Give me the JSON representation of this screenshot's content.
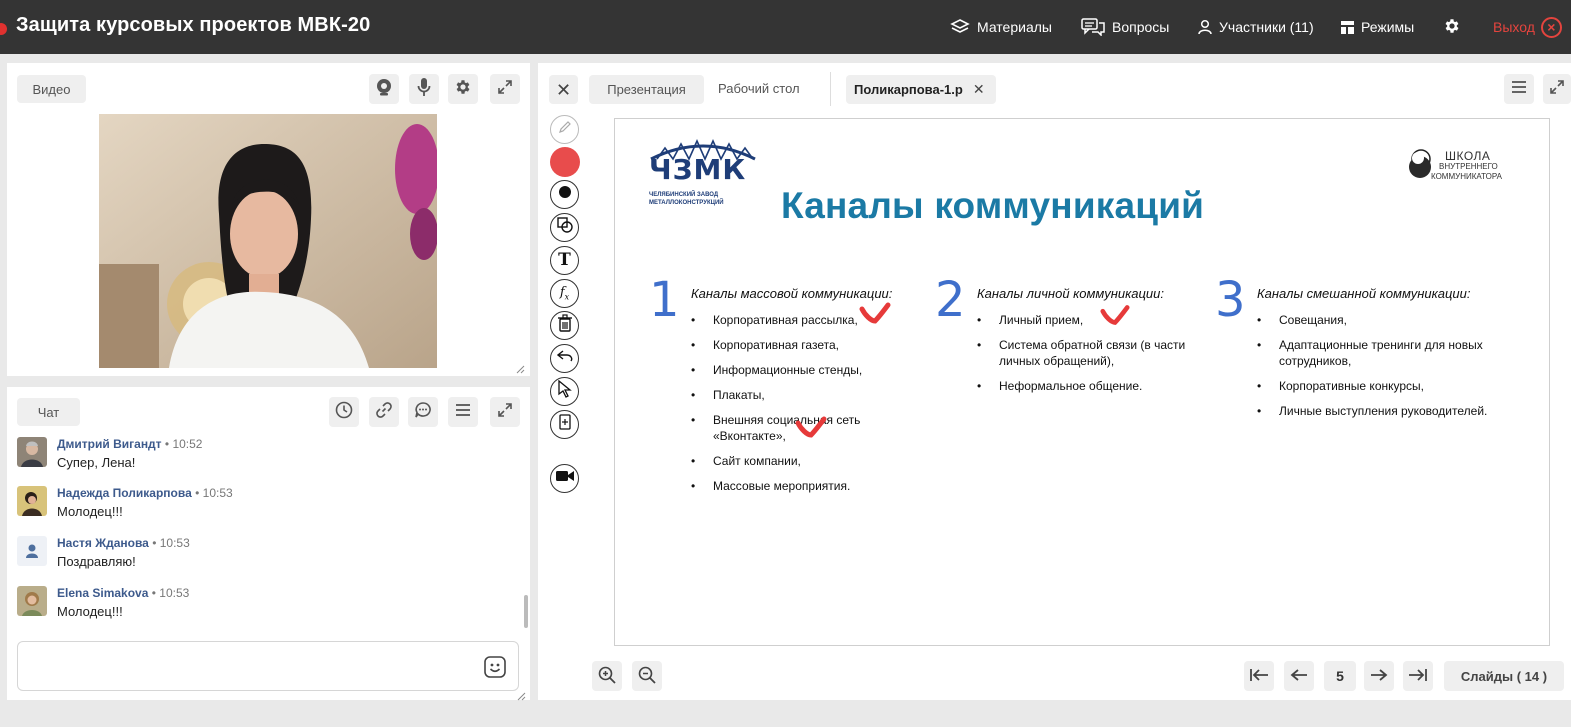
{
  "header": {
    "title": "Защита курсовых проектов МВК-20",
    "nav": {
      "materials": "Материалы",
      "questions": "Вопросы",
      "participants": "Участники (11)",
      "modes": "Режимы",
      "exit": "Выход"
    }
  },
  "video_panel": {
    "tab_label": "Видео"
  },
  "chat_panel": {
    "tab_label": "Чат",
    "messages": [
      {
        "name": "Дмитрий Вигандт",
        "time": "10:52",
        "text": "Супер, Лена!"
      },
      {
        "name": "Надежда Поликарпова",
        "time": "10:53",
        "text": "Молодец!!!"
      },
      {
        "name": "Настя Жданова",
        "time": "10:53",
        "text": "Поздравляю!"
      },
      {
        "name": "Elena Simakova",
        "time": "10:53",
        "text": "Молодец!!!"
      }
    ]
  },
  "presentation": {
    "tabs": {
      "presentation": "Презентация",
      "desktop": "Рабочий стол",
      "file": "Поликарпова-1.р"
    },
    "slide": {
      "logo_left_brand": "ЧЗМК",
      "logo_left_line1": "ЧЕЛЯБИНСКИЙ ЗАВОД",
      "logo_left_line2": "МЕТАЛЛОКОНСТРУКЦИЙ",
      "logo_right_line1": "ШКОЛА",
      "logo_right_line2": "ВНУТРЕННЕГО",
      "logo_right_line3": "КОММУНИКАТОРА",
      "title": "Каналы коммуникаций",
      "columns": [
        {
          "num": "1",
          "heading": "Каналы массовой коммуникации:",
          "items": [
            "Корпоративная рассылка,",
            "Корпоративная газета,",
            "Информационные стенды,",
            "Плакаты,",
            "Внешняя социальная сеть «Вконтакте»,",
            "Сайт компании,",
            "Массовые мероприятия."
          ]
        },
        {
          "num": "2",
          "heading": "Каналы личной коммуникации:",
          "items": [
            "Личный прием,",
            "Система обратной связи (в части личных обращений),",
            "Неформальное общение."
          ]
        },
        {
          "num": "3",
          "heading": "Каналы смешанной коммуникации:",
          "items": [
            "Совещания,",
            "Адаптационные тренинги для новых сотрудников,",
            "Корпоративные конкурсы,",
            "Личные выступления руководителей."
          ]
        }
      ]
    },
    "pager": {
      "current_page": "5",
      "slides_label": "Слайды ( 14 )"
    }
  },
  "colors": {
    "topbar": "#343434",
    "exit": "#e4443e",
    "accent_red": "#e84c4c",
    "slide_title": "#1b7aa5",
    "slide_numbers": "#3f6fcb",
    "chat_name": "#3d5a8c"
  }
}
